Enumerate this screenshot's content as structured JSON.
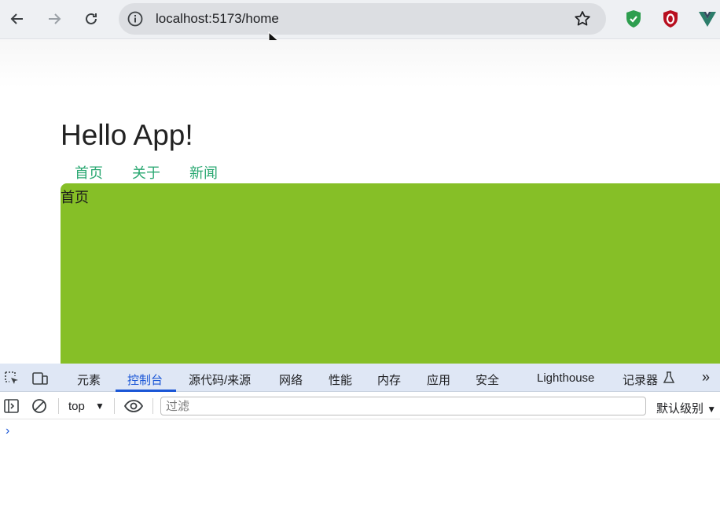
{
  "browser": {
    "url": "localhost:5173/home",
    "colors": {
      "toolbar": "#eef0f3",
      "omnibox": "#dcdee2"
    },
    "extensions": [
      "shield-extension-icon",
      "ublock-extension-icon",
      "vue-devtools-extension-icon"
    ]
  },
  "page": {
    "title": "Hello App!",
    "nav": [
      "首页",
      "关于",
      "新闻"
    ],
    "view_text": "首页",
    "colors": {
      "link": "#2aa872",
      "view_bg": "#86bf27"
    }
  },
  "devtools": {
    "tabs": [
      "元素",
      "控制台",
      "源代码/来源",
      "网络",
      "性能",
      "内存",
      "应用",
      "安全",
      "Lighthouse",
      "记录器"
    ],
    "active_tab": "控制台",
    "more": "»",
    "context": "top",
    "filter_placeholder": "过滤",
    "levels": "默认级别",
    "prompt": "›",
    "colors": {
      "tabs_bg": "#dfe7f5",
      "accent": "#1a56d6"
    }
  }
}
